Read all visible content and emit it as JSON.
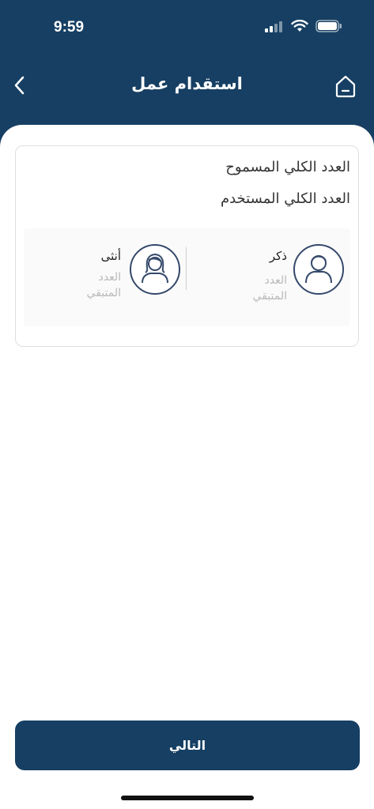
{
  "status_bar": {
    "time": "9:59"
  },
  "nav": {
    "title": "استقدام عمل"
  },
  "card": {
    "total_allowed_label": "العدد الكلي المسموح",
    "total_used_label": "العدد الكلي المستخدم"
  },
  "genders": {
    "male": {
      "label": "ذكر",
      "remaining_label": "العدد المتبقي"
    },
    "female": {
      "label": "أنثى",
      "remaining_label": "العدد المتبقي"
    }
  },
  "actions": {
    "next_label": "التالي"
  },
  "colors": {
    "primary": "#163f63",
    "card_border": "#dedede",
    "muted_text": "#b9b9b9"
  },
  "icons": [
    "signal-icon",
    "wifi-icon",
    "battery-icon",
    "back-chevron-icon",
    "home-icon",
    "male-avatar-icon",
    "female-avatar-icon"
  ]
}
